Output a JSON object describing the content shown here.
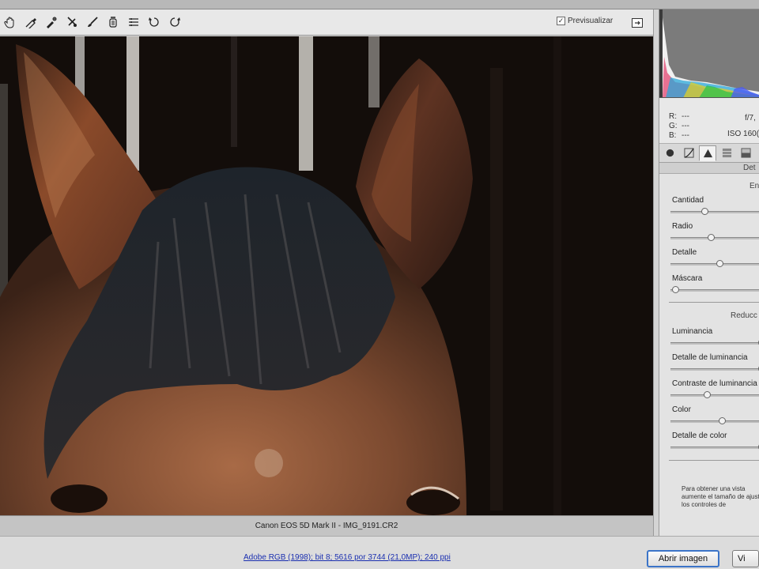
{
  "toolbar": {
    "tools": [
      "hand-icon",
      "white-balance-icon",
      "color-sampler-icon",
      "crop-icon",
      "brush-icon",
      "trash-icon",
      "list-icon",
      "rotate-left-icon",
      "rotate-right-icon"
    ],
    "preview_label": "Previsualizar",
    "preview_checked": true
  },
  "image": {
    "caption": "Canon EOS 5D Mark II - IMG_9191.CR2"
  },
  "readout": {
    "r_label": "R:",
    "r_value": "---",
    "g_label": "G:",
    "g_value": "---",
    "b_label": "B:",
    "b_value": "---",
    "aperture": "f/7,",
    "iso": "ISO 160("
  },
  "panel": {
    "tabs": [
      "basic-tab-icon",
      "tone-curve-tab-icon",
      "detail-tab-icon",
      "hsl-tab-icon",
      "split-tone-tab-icon",
      "lens-tab-icon"
    ],
    "title": "Det",
    "sharpen_header": "En",
    "noise_header": "Reducc",
    "sliders": [
      {
        "label": "Cantidad",
        "value": 0.35
      },
      {
        "label": "Radio",
        "value": 0.42
      },
      {
        "label": "Detalle",
        "value": 0.52
      },
      {
        "label": "Máscara",
        "value": 0.02
      },
      {
        "label": "Luminancia",
        "value": 1.0
      },
      {
        "label": "Detalle de luminancia",
        "value": 1.0
      },
      {
        "label": "Contraste de luminancia",
        "value": 0.38
      },
      {
        "label": "Color",
        "value": 0.55
      },
      {
        "label": "Detalle de color",
        "value": 1.0
      }
    ],
    "note": "Para obtener una vista aumente el tamaño de ajustar los controles de"
  },
  "footer": {
    "workflow_link": "Adobe RGB (1998); bit 8; 5616 por 3744 (21,0MP); 240 ppi",
    "open_button": "Abrir imagen",
    "done_button": "Vi"
  },
  "colors": {
    "accent": "#3b74c8",
    "link": "#1a2fb0"
  }
}
